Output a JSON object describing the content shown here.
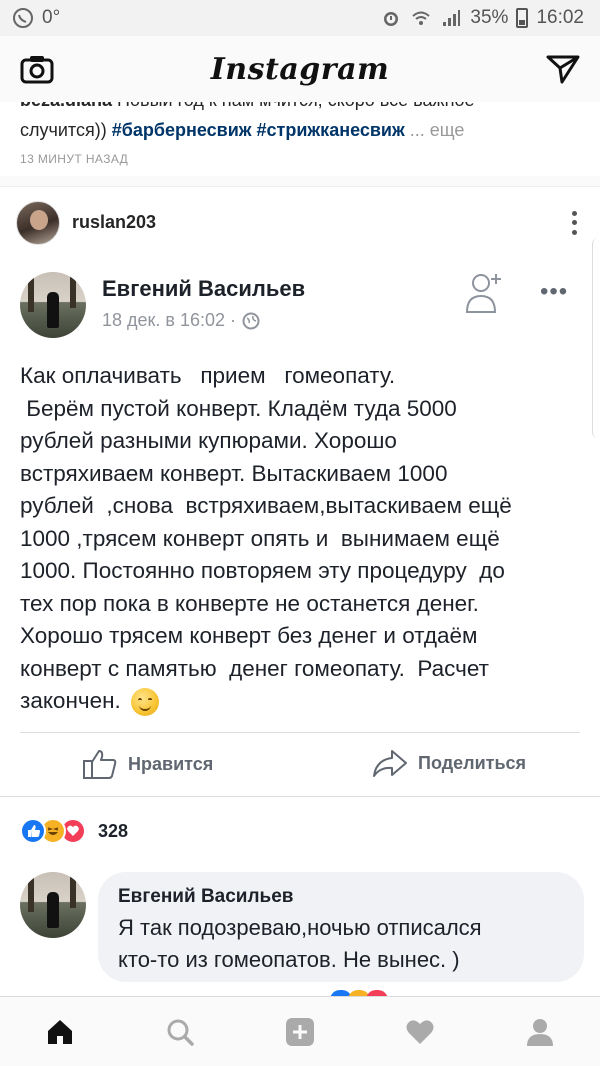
{
  "status_bar": {
    "notif_count": "0°",
    "battery": "35%",
    "time": "16:02"
  },
  "header": {
    "logo": "Instagram"
  },
  "prev_post": {
    "cut_user": "beza.diana",
    "cut_text": " Новый год к нам мчится, скоро всё важное",
    "caption_text": "случится)) ",
    "tags": "#барбернесвиж #стрижканесвиж",
    "more": " ... еще",
    "time_ago": "13 МИНУТ НАЗАД"
  },
  "post": {
    "username": "ruslan203"
  },
  "fb_post": {
    "author": "Евгений Васильев",
    "date": "18 дек. в 16:02 ·",
    "text_lines": [
      "Как оплачивать   прием   гомеопату.",
      " Берём пустой конверт. Кладём туда 5000",
      "рублей разными купюрами. Хорошо",
      "встряхиваем конверт. Вытаскиваем 1000",
      "рублей  ,снова  встряхиваем,вытаскиваем ещё",
      "1000 ,трясем конверт опять и  вынимаем ещё",
      "1000. Постоянно повторяем эту процедуру  до",
      "тех пор пока в конверте не останется денег.",
      "Хорошо трясем конверт без денег и отдаём",
      "конверт с памятью  денег гомеопату.  Расчет",
      "закончен. "
    ],
    "like_label": "Нравится",
    "share_label": "Поделиться",
    "reaction_count": "328",
    "comment": {
      "author": "Евгений Васильев",
      "text_line1": "Я так подозреваю,ночью отписался",
      "text_line2": "кто-то из гомеопатов. Не вынес. )"
    }
  },
  "colors": {
    "hashtag": "#003569",
    "fb_like_blue": "#1877f2",
    "fb_love_red": "#f33e58",
    "fb_haha_yellow": "#f7b125",
    "muted_gray": "#999999"
  }
}
